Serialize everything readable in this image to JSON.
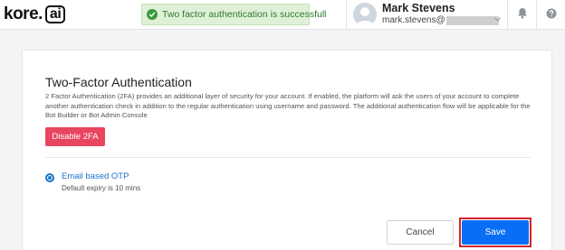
{
  "brand": {
    "logo_text": "kore.",
    "logo_box_text": "ai"
  },
  "toast": {
    "message": "Two factor authentication is successfull",
    "icon": "check-circle-icon",
    "color": "#dff0d8"
  },
  "user": {
    "name": "Mark Stevens",
    "email_prefix": "mark.stevens@"
  },
  "header_icons": {
    "notifications": "bell-icon",
    "help": "help-icon",
    "menu": "chevron-down-icon"
  },
  "card": {
    "title": "Two-Factor Authentication",
    "description": "2 Factor Authentication (2FA) provides an additional layer of security for your account. If enabled, the platform will ask the users of your account to complete another authentication check in addition to the regular authentication using username and password. The additional authentication flow will be applicable for the Bot Builder or Bot Admin Console",
    "disable_button": "Disable 2FA",
    "option": {
      "label": "Email based OTP",
      "sublabel": "Default expiry is 10 mins",
      "selected": true
    },
    "cancel_button": "Cancel",
    "save_button": "Save"
  },
  "colors": {
    "danger": "#e8455f",
    "primary": "#0a6ef5",
    "link": "#1a73c9",
    "highlight_outline": "#d0242b"
  }
}
